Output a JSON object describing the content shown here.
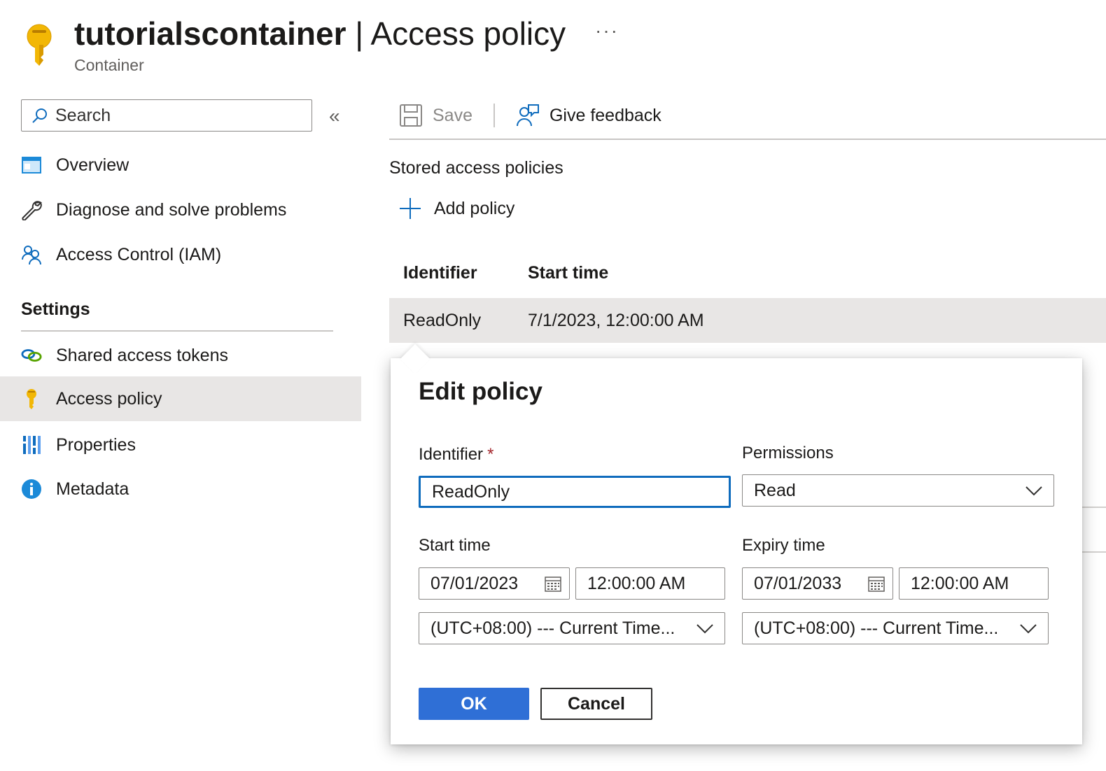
{
  "header": {
    "resource_name": "tutorialscontainer",
    "separator": " | ",
    "blade_title": "Access policy",
    "more_label": "···",
    "subtitle": "Container"
  },
  "sidebar": {
    "search_placeholder": "Search",
    "collapse_label": "«",
    "items": [
      {
        "label": "Overview",
        "icon": "overview-icon"
      },
      {
        "label": "Diagnose and solve problems",
        "icon": "wrench-icon"
      },
      {
        "label": "Access Control (IAM)",
        "icon": "people-icon"
      }
    ],
    "section_label": "Settings",
    "settings_items": [
      {
        "label": "Shared access tokens",
        "icon": "link-icon"
      },
      {
        "label": "Access policy",
        "icon": "key-icon",
        "active": true
      },
      {
        "label": "Properties",
        "icon": "properties-icon"
      },
      {
        "label": "Metadata",
        "icon": "info-icon"
      }
    ]
  },
  "toolbar": {
    "save_label": "Save",
    "feedback_label": "Give feedback"
  },
  "main": {
    "section_title": "Stored access policies",
    "add_policy_label": "Add policy",
    "columns": [
      "Identifier",
      "Start time"
    ],
    "rows": [
      {
        "identifier": "ReadOnly",
        "start_time": "7/1/2023, 12:00:00 AM"
      }
    ]
  },
  "dialog": {
    "title": "Edit policy",
    "identifier_label": "Identifier",
    "required_mark": "*",
    "identifier_value": "ReadOnly",
    "permissions_label": "Permissions",
    "permissions_value": "Read",
    "start_label": "Start time",
    "start_date": "07/01/2023",
    "start_time": "12:00:00 AM",
    "start_tz": "(UTC+08:00) --- Current Time...",
    "expiry_label": "Expiry time",
    "expiry_date": "07/01/2033",
    "expiry_time": "12:00:00 AM",
    "expiry_tz": "(UTC+08:00) --- Current Time...",
    "ok_label": "OK",
    "cancel_label": "Cancel"
  },
  "colors": {
    "accent": "#0f6cbd",
    "primary_button": "#2f6fd6",
    "key_gold": "#f2b705",
    "active_nav_bg": "#e8e6e5"
  }
}
